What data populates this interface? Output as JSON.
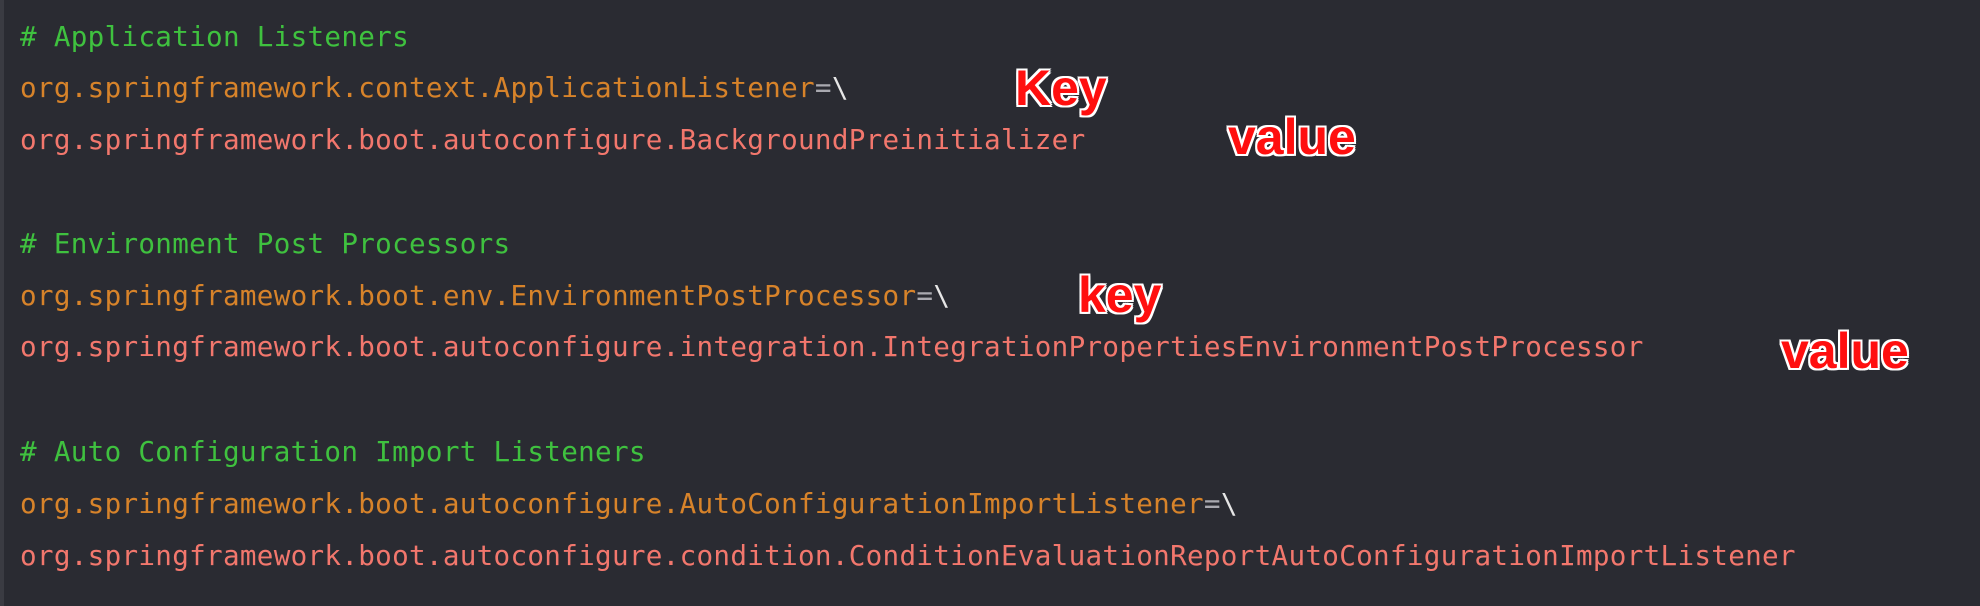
{
  "colors": {
    "background": "#2a2b32",
    "comment": "#3fc13f",
    "key": "#d7832a",
    "value": "#f2776d",
    "operator": "#a9a9b0",
    "annotation": "#ff0f0f"
  },
  "lines": {
    "l1": {
      "comment": "# Application Listeners"
    },
    "l2": {
      "key": "org.springframework.context.ApplicationListener",
      "op": "=",
      "cont": "\\"
    },
    "l3": {
      "value": "org.springframework.boot.autoconfigure.BackgroundPreinitializer"
    },
    "l5": {
      "comment": "# Environment Post Processors"
    },
    "l6": {
      "key": "org.springframework.boot.env.EnvironmentPostProcessor",
      "op": "=",
      "cont": "\\"
    },
    "l7": {
      "value": "org.springframework.boot.autoconfigure.integration.IntegrationPropertiesEnvironmentPostProcessor"
    },
    "l9": {
      "comment": "# Auto Configuration Import Listeners"
    },
    "l10": {
      "key": "org.springframework.boot.autoconfigure.AutoConfigurationImportListener",
      "op": "=",
      "cont": "\\"
    },
    "l11": {
      "value": "org.springframework.boot.autoconfigure.condition.ConditionEvaluationReportAutoConfigurationImportListener"
    }
  },
  "annotations": {
    "key1": "Key",
    "value1": "value",
    "key2": "key",
    "value2": "value"
  }
}
